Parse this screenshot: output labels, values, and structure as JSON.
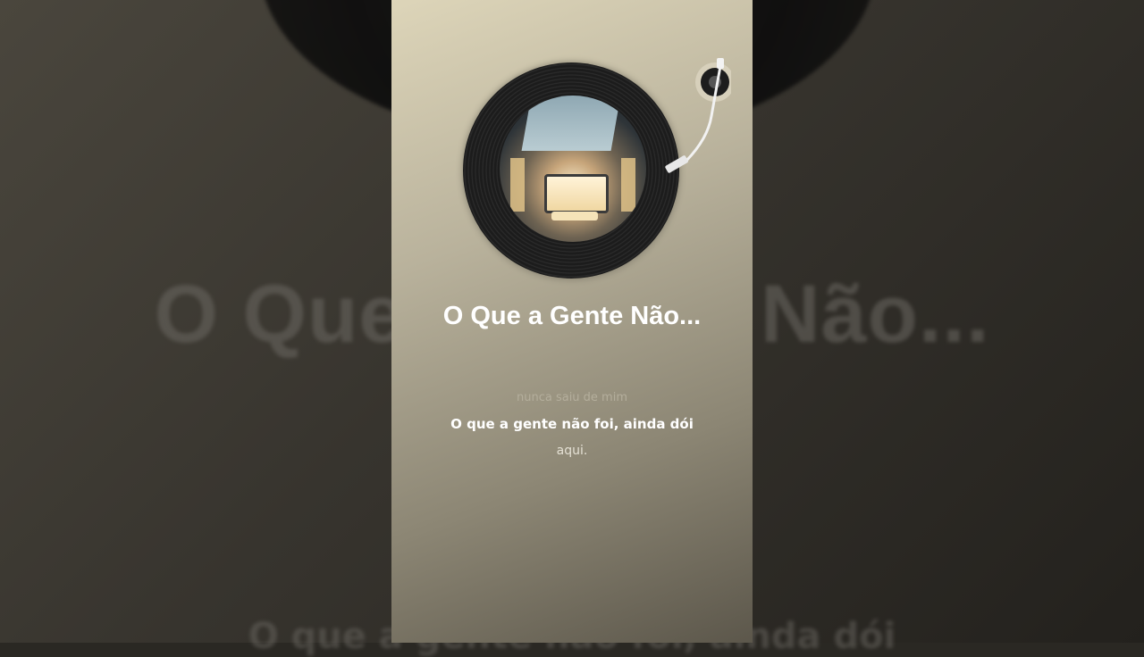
{
  "song": {
    "title": "O Que a Gente Não..."
  },
  "lyrics": {
    "previous": "nunca saiu de mim",
    "current": "O que a gente não foi, ainda dói",
    "next": "aqui."
  },
  "background": {
    "title": "O Que a Gente Não...",
    "lyric": "O que a gente não foi, ainda dói"
  },
  "icons": {
    "record": "vinyl-record-icon",
    "tonearm": "tonearm-icon"
  },
  "colors": {
    "accent": "#ffffff",
    "frame_top": "#ddd5b9",
    "frame_bottom": "#5c574b"
  }
}
